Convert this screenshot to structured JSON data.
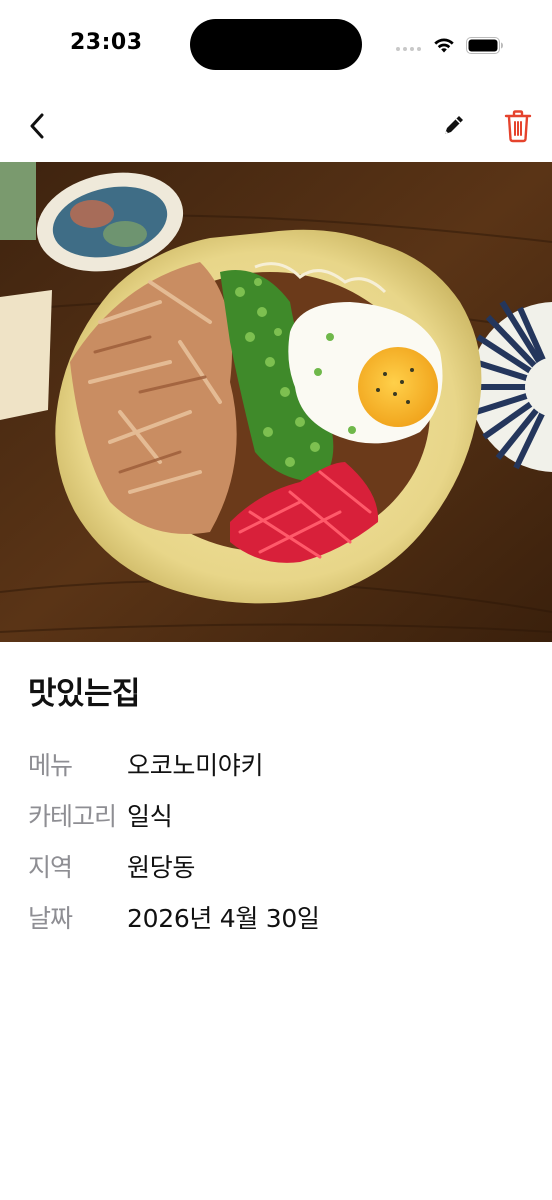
{
  "status_bar": {
    "time": "23:03"
  },
  "nav": {
    "back_icon": "chevron-left-icon",
    "edit_icon": "pencil-icon",
    "delete_icon": "trash-icon",
    "delete_color": "#e5432d"
  },
  "photo": {
    "subject": "okonomiyaki-plate-photo"
  },
  "restaurant": {
    "name": "맛있는집",
    "fields": [
      {
        "label": "메뉴",
        "value": "오코노미야키"
      },
      {
        "label": "카테고리",
        "value": "일식"
      },
      {
        "label": "지역",
        "value": "원당동"
      },
      {
        "label": "날짜",
        "value": "2026년 4월 30일"
      }
    ]
  },
  "colors": {
    "label": "#8e8e93",
    "text": "#111111",
    "background": "#ffffff"
  }
}
